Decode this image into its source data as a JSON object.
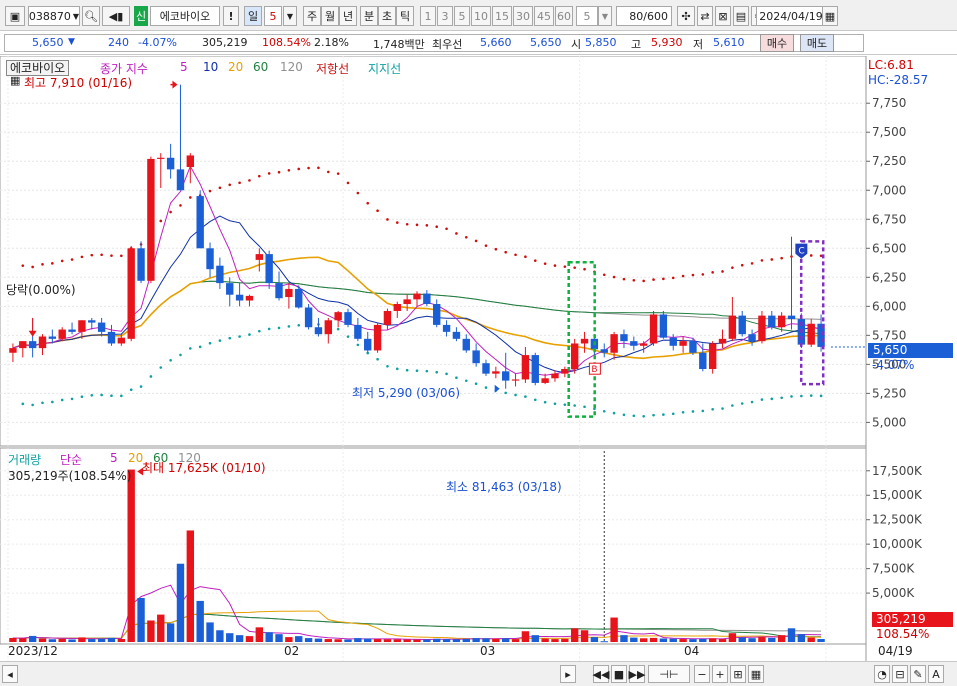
{
  "toolbar": {
    "code": "038870",
    "credit_badge": "신",
    "stock_name": "에코바이오",
    "period_day": "일",
    "period_value": "5",
    "periods": [
      "주",
      "월",
      "년",
      "분",
      "초",
      "틱"
    ],
    "minutes": [
      "1",
      "3",
      "5",
      "10",
      "15",
      "30",
      "45",
      "60"
    ],
    "minute_select": "5",
    "count": "80/600",
    "date": "2024/04/19"
  },
  "quote": {
    "price": "5,650",
    "change_arrow": "▼",
    "change": "240",
    "rate": "-4.07%",
    "volume": "305,219",
    "volume_ratio": "108.54%",
    "turnover": "2.18%",
    "amount": "1,748백만",
    "best_ask_label": "최우선",
    "best_ask": "5,660",
    "best_bid": "5,650",
    "open_label": "시",
    "open": "5,850",
    "high_label": "고",
    "high": "5,930",
    "low_label": "저",
    "low": "5,610",
    "buy_label": "매수",
    "sell_label": "매도"
  },
  "price_panel": {
    "name": "에코바이오",
    "legend_prefix": "종가 지수",
    "legend_items": [
      "5",
      "10",
      "20",
      "60",
      "120"
    ],
    "resistance": "저항선",
    "support": "지지선",
    "high_note": "최고 7,910 (01/16)",
    "low_note": "최저 5,290 (03/06)",
    "dangrak": "당락(0.00%)",
    "lc": "LC:6.81",
    "hc": "HC:-28.57",
    "current_price": "5,650",
    "current_rate": "-4.07%",
    "signal_b": "B",
    "signal_c": "C",
    "y_ticks": [
      "7,750",
      "7,500",
      "7,250",
      "7,000",
      "6,750",
      "6,500",
      "6,250",
      "6,000",
      "5,750",
      "5,500",
      "5,250",
      "5,000"
    ]
  },
  "volume_panel": {
    "title": "거래량",
    "legend_prefix": "단순",
    "legend_items": [
      "5",
      "20",
      "60",
      "120"
    ],
    "current": "305,219주(108.54%)",
    "max_note": "최대 17,625K (01/10)",
    "min_note": "최소 81,463 (03/18)",
    "current_value": "305,219",
    "current_rate": "108.54%",
    "y_ticks": [
      "17,500K",
      "15,000K",
      "12,500K",
      "10,000K",
      "7,500K",
      "5,000K"
    ]
  },
  "x_axis": {
    "labels": [
      "2023/12",
      "02",
      "03",
      "04"
    ],
    "right_label": "04/19"
  },
  "colors": {
    "up": "#e8141c",
    "down": "#1b5fd6",
    "ma5": "#c020c0",
    "ma10": "#1030a8",
    "ma20": "#e8a000",
    "ma60": "#208040",
    "ma120": "#909090",
    "resistance": "#cc1010",
    "support": "#10a0a0"
  },
  "chart_data": {
    "type": "candlestick",
    "title": "에코바이오",
    "ylim": [
      4900,
      7950
    ],
    "volume_ylim": [
      0,
      18500
    ],
    "candles": [
      [
        5600,
        5680,
        5520,
        5640,
        410
      ],
      [
        5640,
        5700,
        5560,
        5700,
        380
      ],
      [
        5700,
        5900,
        5560,
        5640,
        620
      ],
      [
        5640,
        5760,
        5580,
        5740,
        350
      ],
      [
        5740,
        5800,
        5680,
        5720,
        280
      ],
      [
        5720,
        5820,
        5700,
        5800,
        320
      ],
      [
        5800,
        5860,
        5760,
        5780,
        260
      ],
      [
        5780,
        5880,
        5720,
        5880,
        470
      ],
      [
        5880,
        5900,
        5800,
        5860,
        300
      ],
      [
        5860,
        5900,
        5740,
        5780,
        350
      ],
      [
        5780,
        5840,
        5660,
        5680,
        420
      ],
      [
        5680,
        5760,
        5660,
        5730,
        310
      ],
      [
        5720,
        6520,
        5700,
        6500,
        17625
      ],
      [
        6500,
        6560,
        6200,
        6220,
        4500
      ],
      [
        6220,
        7290,
        6200,
        7270,
        2200
      ],
      [
        7270,
        7320,
        7020,
        7280,
        2800
      ],
      [
        7280,
        7400,
        7100,
        7180,
        1900
      ],
      [
        7180,
        7910,
        7000,
        7000,
        8000
      ],
      [
        7200,
        7320,
        7060,
        7300,
        11400
      ],
      [
        6950,
        7000,
        6520,
        6500,
        4200
      ],
      [
        6500,
        6550,
        6250,
        6320,
        2000
      ],
      [
        6350,
        6420,
        6150,
        6200,
        1200
      ],
      [
        6200,
        6250,
        6000,
        6100,
        900
      ],
      [
        6100,
        6200,
        6000,
        6050,
        700
      ],
      [
        6050,
        6100,
        6000,
        6090,
        600
      ],
      [
        6400,
        6500,
        6300,
        6450,
        1500
      ],
      [
        6450,
        6480,
        6150,
        6200,
        1000
      ],
      [
        6200,
        6300,
        6050,
        6070,
        800
      ],
      [
        6080,
        6200,
        5980,
        6150,
        500
      ],
      [
        6150,
        6180,
        5980,
        5990,
        600
      ],
      [
        5990,
        6020,
        5800,
        5820,
        400
      ],
      [
        5820,
        5900,
        5740,
        5760,
        350
      ],
      [
        5760,
        5900,
        5680,
        5880,
        300
      ],
      [
        5880,
        5960,
        5820,
        5950,
        280
      ],
      [
        5950,
        5980,
        5820,
        5840,
        250
      ],
      [
        5840,
        5900,
        5700,
        5720,
        400
      ],
      [
        5720,
        5780,
        5600,
        5620,
        350
      ],
      [
        5620,
        5860,
        5600,
        5840,
        300
      ],
      [
        5840,
        5980,
        5800,
        5960,
        280
      ],
      [
        5960,
        6040,
        5900,
        6020,
        270
      ],
      [
        6020,
        6100,
        5960,
        6060,
        250
      ],
      [
        6060,
        6130,
        6000,
        6110,
        240
      ],
      [
        6110,
        6140,
        6000,
        6020,
        260
      ],
      [
        6020,
        6060,
        5820,
        5840,
        330
      ],
      [
        5840,
        5880,
        5740,
        5780,
        300
      ],
      [
        5780,
        5820,
        5700,
        5720,
        280
      ],
      [
        5720,
        5760,
        5600,
        5620,
        320
      ],
      [
        5620,
        5680,
        5480,
        5510,
        400
      ],
      [
        5510,
        5540,
        5400,
        5420,
        380
      ],
      [
        5420,
        5480,
        5380,
        5440,
        330
      ],
      [
        5440,
        5600,
        5290,
        5360,
        380
      ],
      [
        5360,
        5420,
        5310,
        5370,
        290
      ],
      [
        5370,
        5650,
        5340,
        5580,
        1100
      ],
      [
        5580,
        5600,
        5320,
        5340,
        700
      ],
      [
        5340,
        5420,
        5330,
        5380,
        350
      ],
      [
        5380,
        5450,
        5350,
        5420,
        300
      ],
      [
        5420,
        5480,
        5390,
        5460,
        320
      ],
      [
        5460,
        5720,
        5420,
        5680,
        1400
      ],
      [
        5680,
        5780,
        5600,
        5720,
        1200
      ],
      [
        5720,
        5760,
        5580,
        5630,
        500
      ],
      [
        5630,
        5680,
        5560,
        5600,
        81
      ],
      [
        5600,
        5780,
        5540,
        5760,
        2500
      ],
      [
        5760,
        5800,
        5640,
        5700,
        700
      ],
      [
        5700,
        5740,
        5620,
        5660,
        450
      ],
      [
        5660,
        5700,
        5600,
        5680,
        380
      ],
      [
        5680,
        5960,
        5660,
        5930,
        420
      ],
      [
        5930,
        5960,
        5720,
        5730,
        360
      ],
      [
        5730,
        5760,
        5620,
        5660,
        340
      ],
      [
        5660,
        5740,
        5600,
        5700,
        300
      ],
      [
        5700,
        5730,
        5580,
        5600,
        290
      ],
      [
        5600,
        5680,
        5440,
        5460,
        320
      ],
      [
        5460,
        5700,
        5420,
        5680,
        380
      ],
      [
        5680,
        5800,
        5640,
        5720,
        300
      ],
      [
        5720,
        6080,
        5700,
        5920,
        900
      ],
      [
        5920,
        5960,
        5740,
        5760,
        460
      ],
      [
        5760,
        5800,
        5660,
        5700,
        390
      ],
      [
        5700,
        5960,
        5680,
        5920,
        500
      ],
      [
        5920,
        5960,
        5800,
        5820,
        420
      ],
      [
        5820,
        5950,
        5780,
        5920,
        700
      ],
      [
        5920,
        6600,
        5800,
        5890,
        1400
      ],
      [
        5890,
        5940,
        5640,
        5670,
        800
      ],
      [
        5670,
        5890,
        5650,
        5850,
        450
      ],
      [
        5850,
        5930,
        5610,
        5650,
        305
      ]
    ]
  }
}
